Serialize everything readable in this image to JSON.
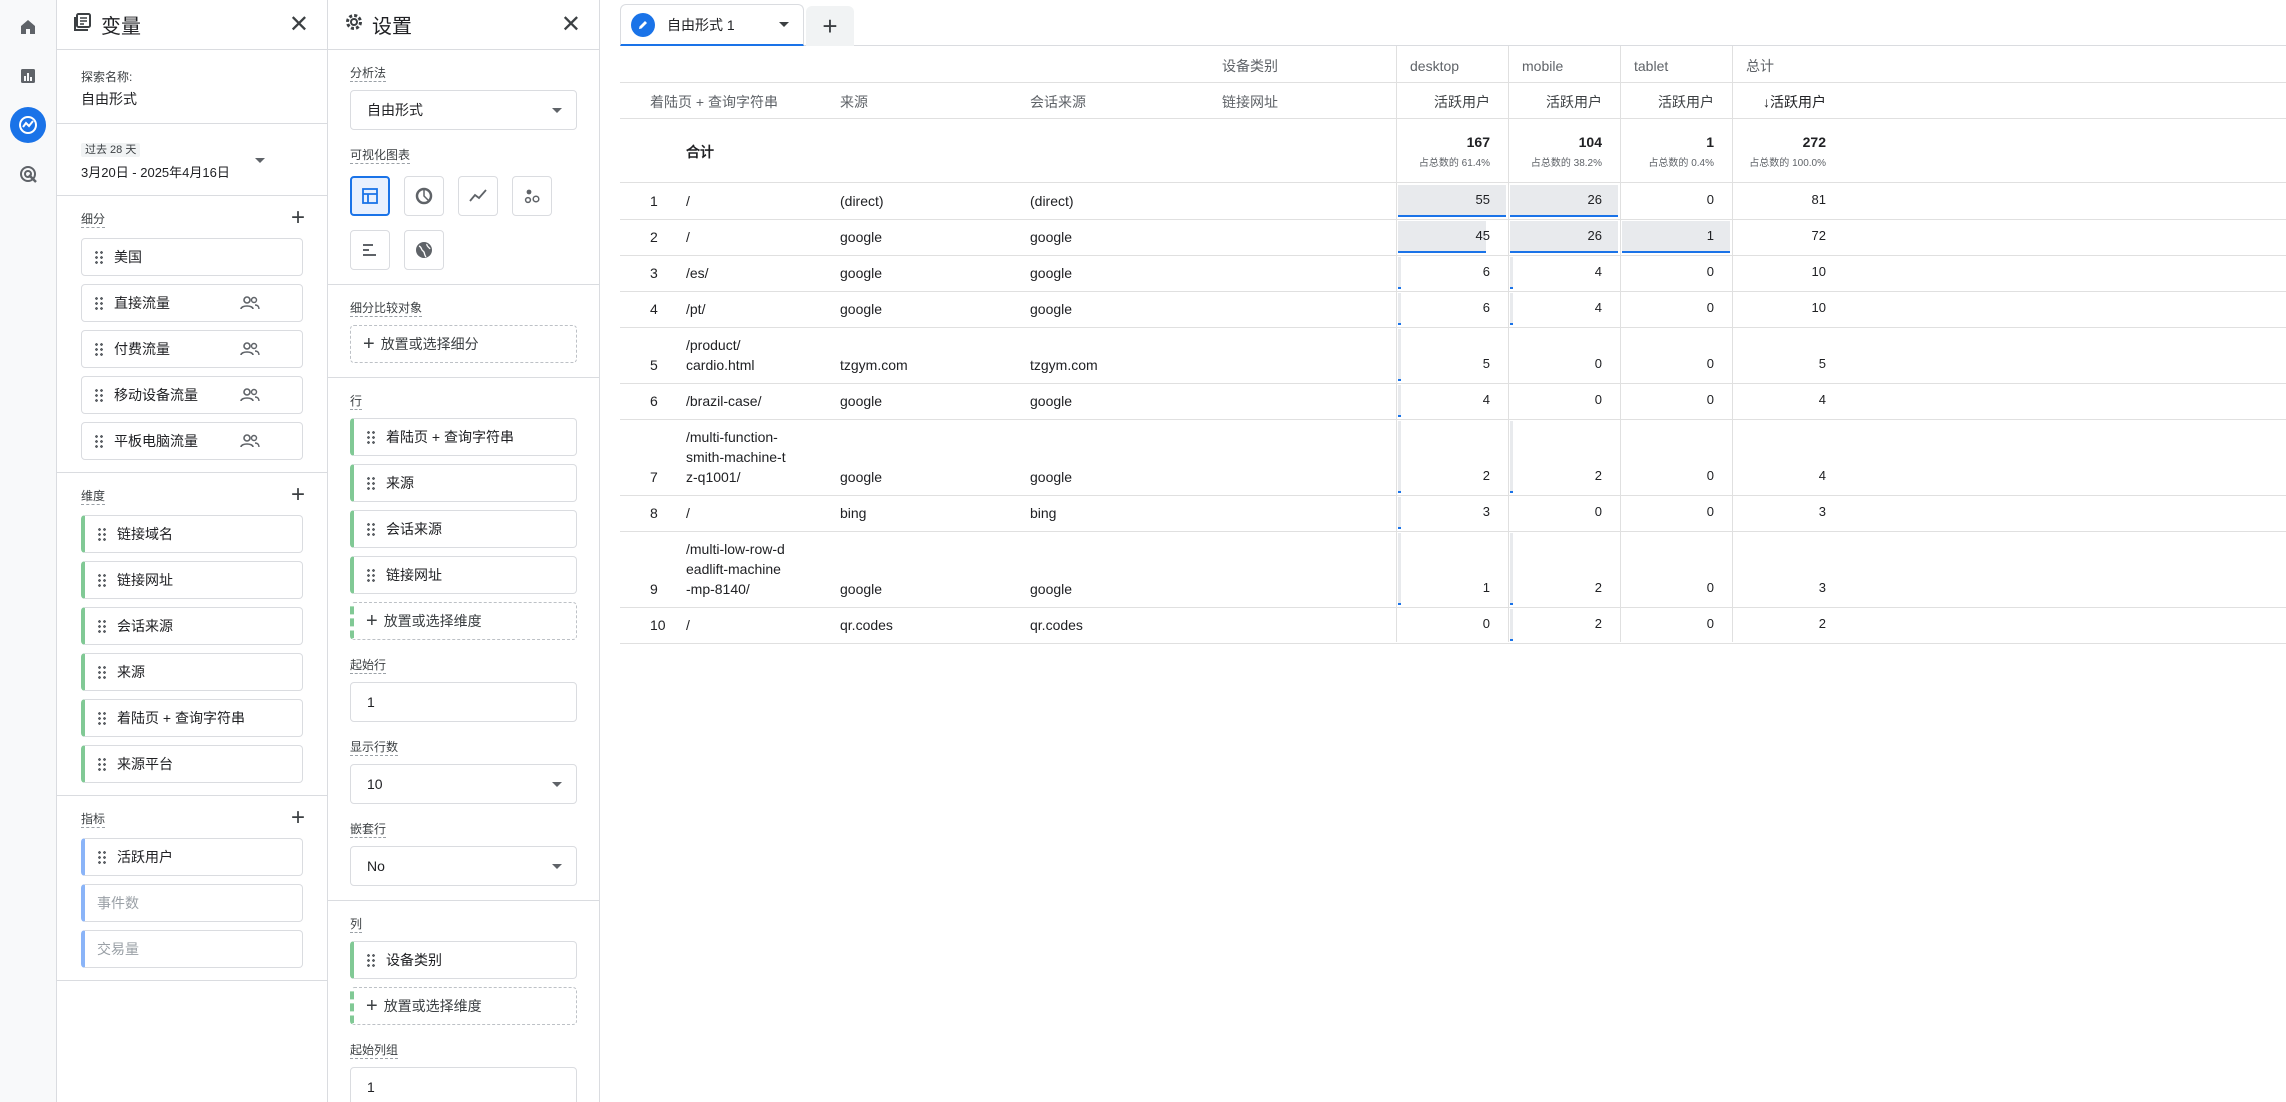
{
  "variables": {
    "title": "变量",
    "exploration_name_label": "探索名称:",
    "exploration_name": "自由形式",
    "date_range_label": "过去 28 天",
    "date_range": "3月20日 - 2025年4月16日",
    "segments_label": "细分",
    "segments": [
      "美国",
      "直接流量",
      "付费流量",
      "移动设备流量",
      "平板电脑流量"
    ],
    "dimensions_label": "维度",
    "dimensions": [
      "链接域名",
      "链接网址",
      "会话来源",
      "来源",
      "着陆页 + 查询字符串",
      "来源平台"
    ],
    "metrics_label": "指标",
    "metrics": [
      "活跃用户",
      "事件数",
      "交易量"
    ]
  },
  "settings": {
    "title": "设置",
    "technique_label": "分析法",
    "technique": "自由形式",
    "viz_label": "可视化图表",
    "segment_compare_label": "细分比较对象",
    "segment_drop": "放置或选择细分",
    "rows_label": "行",
    "rows": [
      "着陆页 + 查询字符串",
      "来源",
      "会话来源",
      "链接网址"
    ],
    "rows_drop": "放置或选择维度",
    "start_row_label": "起始行",
    "start_row": "1",
    "show_rows_label": "显示行数",
    "show_rows": "10",
    "nested_rows_label": "嵌套行",
    "nested_rows": "No",
    "columns_label": "列",
    "columns": [
      "设备类别"
    ],
    "columns_drop": "放置或选择维度",
    "start_col_group_label": "起始列组",
    "start_col_group": "1"
  },
  "tabs": {
    "active": "自由形式 1",
    "add": "+"
  },
  "table": {
    "column_dimension_label": "设备类别",
    "device_headers": [
      "desktop",
      "mobile",
      "tablet",
      "总计"
    ],
    "row_headers": [
      "着陆页 + 查询字符串",
      "来源",
      "会话来源",
      "链接网址"
    ],
    "metric_headers": [
      "活跃用户",
      "活跃用户",
      "活跃用户",
      "↓活跃用户"
    ],
    "totals_label": "合计",
    "totals": [
      "167",
      "104",
      "1",
      "272"
    ],
    "totals_pct": [
      "占总数的 61.4%",
      "占总数的 38.2%",
      "占总数的 0.4%",
      "占总数的 100.0%"
    ],
    "rows": [
      {
        "idx": "1",
        "page": "/",
        "source": "(direct)",
        "session_source": "(direct)",
        "desktop": "55",
        "mobile": "26",
        "tablet": "0",
        "total": "81"
      },
      {
        "idx": "2",
        "page": "/",
        "source": "google",
        "session_source": "google",
        "desktop": "45",
        "mobile": "26",
        "tablet": "1",
        "total": "72"
      },
      {
        "idx": "3",
        "page": "/es/",
        "source": "google",
        "session_source": "google",
        "desktop": "6",
        "mobile": "4",
        "tablet": "0",
        "total": "10"
      },
      {
        "idx": "4",
        "page": "/pt/",
        "source": "google",
        "session_source": "google",
        "desktop": "6",
        "mobile": "4",
        "tablet": "0",
        "total": "10"
      },
      {
        "idx": "5",
        "page_lines": [
          "/product/",
          "cardio.html"
        ],
        "source": "tzgym.com",
        "session_source": "tzgym.com",
        "desktop": "5",
        "mobile": "0",
        "tablet": "0",
        "total": "5"
      },
      {
        "idx": "6",
        "page": "/brazil-case/",
        "source": "google",
        "session_source": "google",
        "desktop": "4",
        "mobile": "0",
        "tablet": "0",
        "total": "4"
      },
      {
        "idx": "7",
        "page_lines": [
          "/multi-function-",
          "smith-machine-t",
          "z-q1001/"
        ],
        "source": "google",
        "session_source": "google",
        "desktop": "2",
        "mobile": "2",
        "tablet": "0",
        "total": "4"
      },
      {
        "idx": "8",
        "page": "/",
        "source": "bing",
        "session_source": "bing",
        "desktop": "3",
        "mobile": "0",
        "tablet": "0",
        "total": "3"
      },
      {
        "idx": "9",
        "page_lines": [
          "/multi-low-row-d",
          "eadlift-machine",
          "-mp-8140/"
        ],
        "source": "google",
        "session_source": "google",
        "desktop": "1",
        "mobile": "2",
        "tablet": "0",
        "total": "3"
      },
      {
        "idx": "10",
        "page": "/",
        "source": "qr.codes",
        "session_source": "qr.codes",
        "desktop": "0",
        "mobile": "2",
        "tablet": "0",
        "total": "2"
      }
    ]
  },
  "colors": {
    "accent": "#1a73e8",
    "dimension_chip": "#81c995",
    "metric_chip": "#8ab4f8"
  }
}
